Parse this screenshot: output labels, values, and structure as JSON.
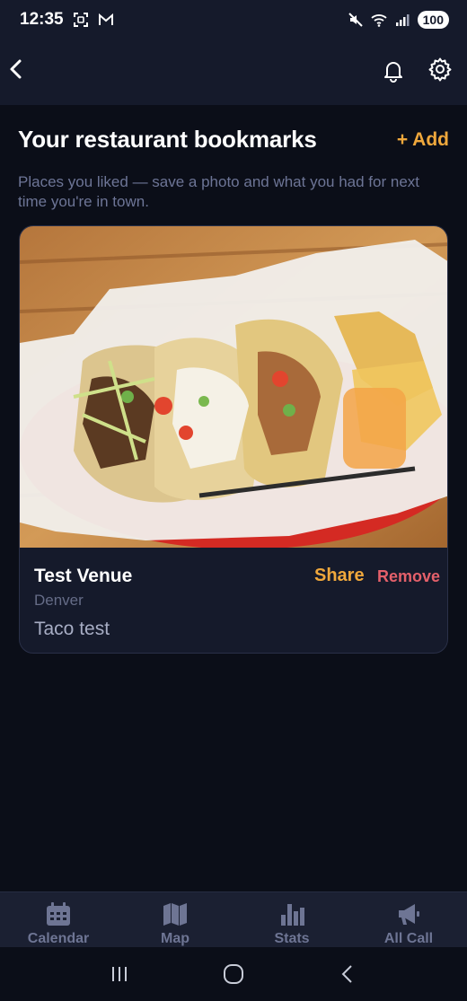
{
  "status_bar": {
    "time": "12:35",
    "battery": "100",
    "icons": [
      "screenshot-icon",
      "gmail-icon",
      "mute-icon",
      "wifi-icon",
      "signal-icon"
    ]
  },
  "header": {
    "back_icon": "chevron-left-icon",
    "bell_icon": "bell-icon",
    "settings_icon": "gear-icon"
  },
  "main": {
    "title": "Your restaurant bookmarks",
    "add_label": "+ Add",
    "subtitle": "Places you liked — save a photo and what you had for next time you're in town."
  },
  "bookmarks": [
    {
      "name": "Test Venue",
      "city": "Denver",
      "note": "Taco test",
      "share_label": "Share",
      "remove_label": "Remove",
      "photo": "tacos-photo"
    }
  ],
  "tabs": [
    {
      "label": "Calendar",
      "icon": "calendar-icon"
    },
    {
      "label": "Map",
      "icon": "map-icon"
    },
    {
      "label": "Stats",
      "icon": "stats-icon"
    },
    {
      "label": "All Call",
      "icon": "megaphone-icon"
    }
  ],
  "system_nav": [
    "recents-icon",
    "home-icon",
    "back-icon"
  ],
  "colors": {
    "background": "#0b0e18",
    "surface": "#151a2b",
    "accent": "#f0a83c",
    "danger": "#e4606a",
    "muted": "#6d7596"
  }
}
